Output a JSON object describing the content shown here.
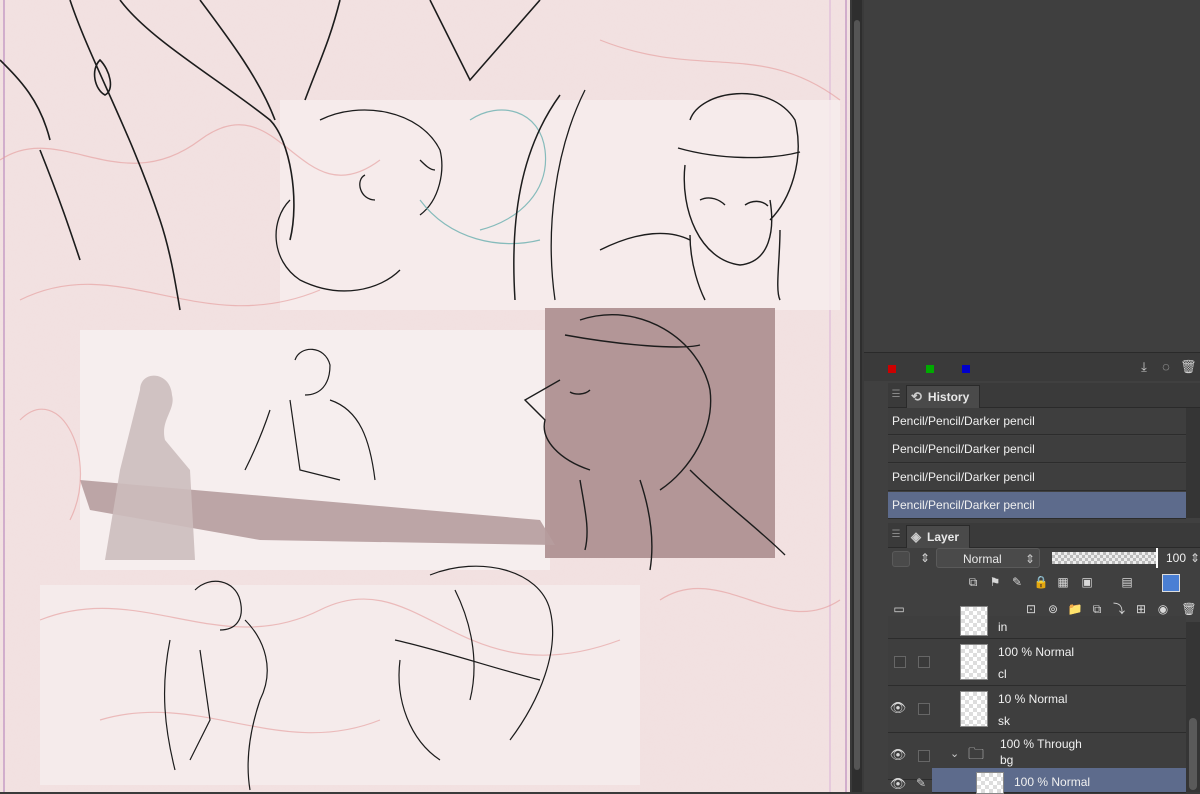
{
  "history": {
    "tab_label": "History",
    "items": [
      {
        "label": "Pencil/Pencil/Darker pencil"
      },
      {
        "label": "Pencil/Pencil/Darker pencil"
      },
      {
        "label": "Pencil/Pencil/Darker pencil"
      },
      {
        "label": "Pencil/Pencil/Darker pencil"
      }
    ],
    "selected_index": 3
  },
  "color_swatches": [
    "#cc0000",
    "#00aa00",
    "#0000cc"
  ],
  "layer": {
    "tab_label": "Layer",
    "blend_mode": "Normal",
    "opacity": "100",
    "rows": [
      {
        "opacity_mode": "",
        "name": "in"
      },
      {
        "opacity_mode": "100 % Normal",
        "name": "cl"
      },
      {
        "opacity_mode": "10 % Normal",
        "name": "sk"
      },
      {
        "opacity_mode": "100 % Through",
        "name": "bg"
      },
      {
        "opacity_mode": "100 % Normal",
        "name": ""
      }
    ]
  },
  "colors": {
    "selection": "#5d6b8c",
    "panel": "#404040",
    "canvas_paper": "#f2e1e1"
  }
}
